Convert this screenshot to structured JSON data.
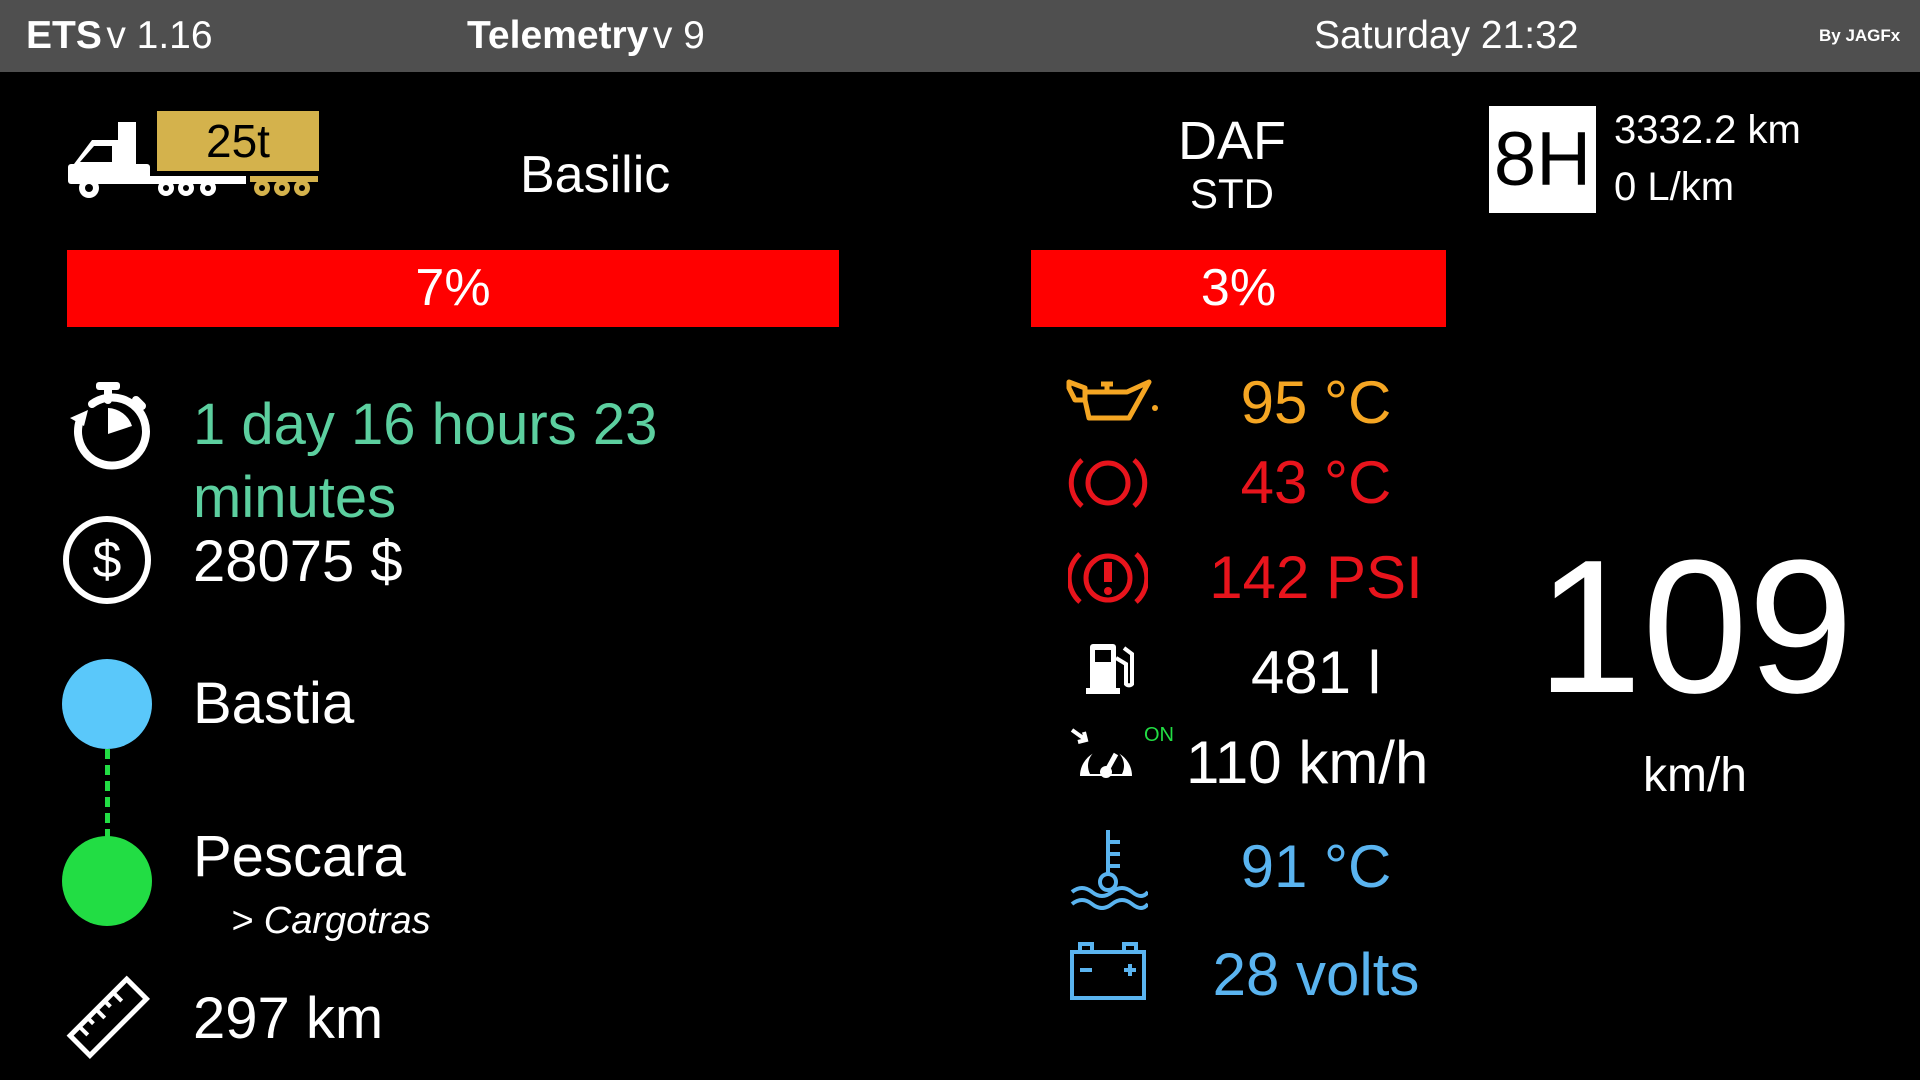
{
  "topbar": {
    "app_name": "ETS",
    "app_version": "v 1.16",
    "telemetry_name": "Telemetry",
    "telemetry_version": "v 9",
    "datetime": "Saturday 21:32",
    "author": "By JAGFx",
    "background": "#4f4f4f"
  },
  "job": {
    "cargo_weight": "25t",
    "cargo_name": "Basilic",
    "trailer_damage": "7%",
    "trailer_damage_fraction": 0.07,
    "remaining_time": "1 day 16 hours 23 minutes",
    "income": "28075 $",
    "source_city": "Bastia",
    "destination_city": "Pescara",
    "destination_company": "> Cargotras",
    "distance": "297 km",
    "source_color": "#5ac8fa",
    "destination_color": "#22dd44"
  },
  "truck": {
    "make": "DAF",
    "model": "STD",
    "truck_damage": "3%",
    "truck_damage_fraction": 0.03,
    "gear": "8H",
    "odometer": "3332.2 km",
    "fuel_consumption": "0 L/km",
    "speed": "109",
    "speed_unit": "km/h"
  },
  "gauges": {
    "oil_temp": "95 °C",
    "brake_temp": "43 °C",
    "air_pressure": "142 PSI",
    "fuel": "481 l",
    "cruise_state": "ON",
    "cruise_speed": "110 km/h",
    "water_temp": "91 °C",
    "battery": "28 volts",
    "colors": {
      "warning": "#f5a623",
      "alert": "#e8141c",
      "normal": "#ffffff",
      "info": "#5ab4f0",
      "on": "#22dd44"
    }
  }
}
